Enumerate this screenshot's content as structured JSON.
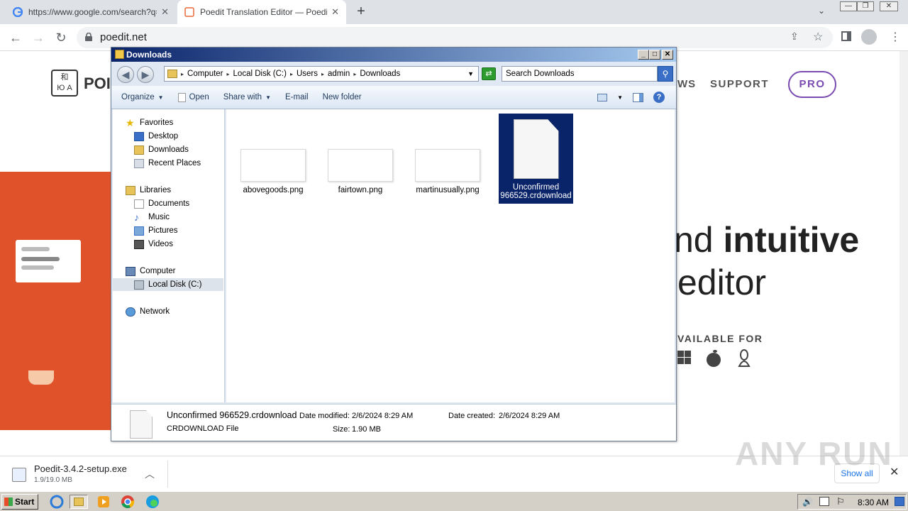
{
  "browser": {
    "tabs": [
      {
        "title": "https://www.google.com/search?q=",
        "favicon": "google-icon"
      },
      {
        "title": "Poedit Translation Editor — Poedit",
        "favicon": "poedit-icon"
      }
    ],
    "url": "poedit.net"
  },
  "webpage": {
    "logo_glyphs": "和\nЮ A",
    "logo_text": "POI",
    "nav_partial": "WS",
    "nav_support": "SUPPORT",
    "nav_pro": "PRO",
    "hero_line1_regular": "nd ",
    "hero_line1_bold": "intuitive",
    "hero_line2": "editor",
    "available_for": "VAILABLE FOR"
  },
  "explorer": {
    "title": "Downloads",
    "breadcrumb": [
      "Computer",
      "Local Disk (C:)",
      "Users",
      "admin",
      "Downloads"
    ],
    "search_placeholder": "Search Downloads",
    "commands": {
      "organize": "Organize",
      "open": "Open",
      "share_with": "Share with",
      "email": "E-mail",
      "new_folder": "New folder"
    },
    "nav": {
      "favorites": "Favorites",
      "desktop": "Desktop",
      "downloads": "Downloads",
      "recent_places": "Recent Places",
      "libraries": "Libraries",
      "documents": "Documents",
      "music": "Music",
      "pictures": "Pictures",
      "videos": "Videos",
      "computer": "Computer",
      "local_disk": "Local Disk (C:)",
      "network": "Network"
    },
    "files": [
      {
        "name": "abovegoods.png"
      },
      {
        "name": "fairtown.png"
      },
      {
        "name": "martinusually.png"
      },
      {
        "name_line1": "Unconfirmed",
        "name_line2": "966529.crdownload"
      }
    ],
    "details": {
      "name": "Unconfirmed 966529.crdownload",
      "type": "CRDOWNLOAD File",
      "date_modified_label": "Date modified:",
      "date_modified": "2/6/2024 8:29 AM",
      "date_created_label": "Date created:",
      "date_created": "2/6/2024 8:29 AM",
      "size_label": "Size:",
      "size": "1.90 MB"
    }
  },
  "download_bar": {
    "filename": "Poedit-3.4.2-setup.exe",
    "progress": "1.9/19.0 MB",
    "show_all": "Show all"
  },
  "watermark": "ANY RUN",
  "taskbar": {
    "start": "Start",
    "clock": "8:30 AM"
  }
}
